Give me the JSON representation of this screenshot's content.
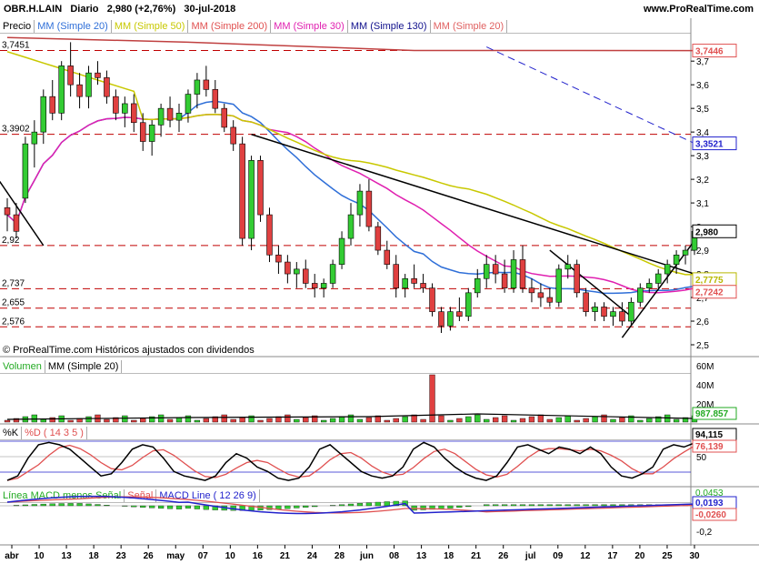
{
  "header": {
    "symbol": "OBR.H.LAIN",
    "period": "Diario",
    "last": "2,980 (+2,76%)",
    "date": "30-jul-2018",
    "site": "www.ProRealTime.com"
  },
  "legends": {
    "price": [
      "Precio",
      "MM (Simple 20)",
      "MM (Simple 50)",
      "MM (Simple 200)",
      "MM (Simple 30)",
      "MM (Simple 130)",
      "MM (Simple 20)"
    ],
    "price_colors": [
      "#000000",
      "#2f6fd8",
      "#c8c800",
      "#e05050",
      "#e020b0",
      "#10108c",
      "#e06060"
    ],
    "volume": [
      "Volumen",
      "MM (Simple 20)"
    ],
    "volume_colors": [
      "#22aa22",
      "#000000"
    ],
    "stoch": [
      "%K",
      "%D ( 14 3 5 )"
    ],
    "stoch_colors": [
      "#000000",
      "#e05050"
    ],
    "macd": [
      "Línea MACD menos Señal",
      "Señal",
      "MACD Line ( 12 26 9)"
    ],
    "macd_colors": [
      "#22aa22",
      "#e05050",
      "#2222cc"
    ]
  },
  "credit": "© ProRealTime.com  Históricos ajustados con dividendos",
  "levels_left": [
    "3,7451",
    "3,3902",
    "2,92",
    "2,737",
    "2,655",
    "2,576"
  ],
  "price_boxes": [
    {
      "text": "3,7446",
      "color": "#e05050"
    },
    {
      "text": "3,3521",
      "color": "#2222cc"
    },
    {
      "text": "2,980",
      "color": "#000000"
    },
    {
      "text": "2,7775",
      "color": "#b8b800"
    },
    {
      "text": "2,7242",
      "color": "#e05050"
    }
  ],
  "volume_axis": [
    "60M",
    "40M",
    "20M"
  ],
  "volume_box": "987.857",
  "stoch_axis": [
    "50"
  ],
  "stoch_boxes": [
    "94,115",
    "76,139"
  ],
  "macd_axis": [
    "0",
    "-0,2"
  ],
  "macd_boxes": [
    "0,0193",
    "-0,0260"
  ],
  "macd_partial": "0,0453",
  "chart_data": {
    "type": "candlestick",
    "y_ticks": [
      "3,7",
      "3,6",
      "3,5",
      "3,4",
      "3,3",
      "3,2",
      "3,1",
      "3",
      "2,9",
      "2,8",
      "2,7",
      "2,6",
      "2,5"
    ],
    "ylim": [
      2.45,
      3.82
    ],
    "x_ticks": [
      "abr",
      "10",
      "13",
      "18",
      "23",
      "26",
      "may",
      "07",
      "10",
      "16",
      "21",
      "24",
      "28",
      "jun",
      "08",
      "13",
      "18",
      "21",
      "26",
      "jul",
      "09",
      "12",
      "17",
      "20",
      "25",
      "30"
    ],
    "candles": [
      [
        3.08,
        3.12,
        2.98,
        3.05
      ],
      [
        3.05,
        3.1,
        2.95,
        2.98
      ],
      [
        3.12,
        3.38,
        3.1,
        3.35
      ],
      [
        3.35,
        3.45,
        3.25,
        3.4
      ],
      [
        3.4,
        3.58,
        3.35,
        3.55
      ],
      [
        3.55,
        3.62,
        3.45,
        3.48
      ],
      [
        3.48,
        3.7,
        3.45,
        3.68
      ],
      [
        3.68,
        3.78,
        3.55,
        3.6
      ],
      [
        3.6,
        3.65,
        3.5,
        3.55
      ],
      [
        3.55,
        3.68,
        3.5,
        3.65
      ],
      [
        3.65,
        3.7,
        3.6,
        3.63
      ],
      [
        3.63,
        3.66,
        3.52,
        3.55
      ],
      [
        3.55,
        3.58,
        3.45,
        3.48
      ],
      [
        3.48,
        3.55,
        3.42,
        3.52
      ],
      [
        3.52,
        3.56,
        3.4,
        3.44
      ],
      [
        3.44,
        3.48,
        3.32,
        3.36
      ],
      [
        3.36,
        3.45,
        3.3,
        3.43
      ],
      [
        3.43,
        3.52,
        3.38,
        3.5
      ],
      [
        3.5,
        3.55,
        3.42,
        3.45
      ],
      [
        3.45,
        3.52,
        3.4,
        3.48
      ],
      [
        3.48,
        3.58,
        3.44,
        3.56
      ],
      [
        3.56,
        3.65,
        3.5,
        3.62
      ],
      [
        3.62,
        3.68,
        3.55,
        3.58
      ],
      [
        3.58,
        3.62,
        3.48,
        3.5
      ],
      [
        3.5,
        3.52,
        3.4,
        3.42
      ],
      [
        3.42,
        3.45,
        3.32,
        3.35
      ],
      [
        3.35,
        3.38,
        2.92,
        2.95
      ],
      [
        2.95,
        3.3,
        2.9,
        3.28
      ],
      [
        3.28,
        3.3,
        3.02,
        3.05
      ],
      [
        3.05,
        3.08,
        2.85,
        2.88
      ],
      [
        2.88,
        2.92,
        2.8,
        2.85
      ],
      [
        2.85,
        2.88,
        2.76,
        2.8
      ],
      [
        2.8,
        2.85,
        2.74,
        2.82
      ],
      [
        2.82,
        2.86,
        2.74,
        2.76
      ],
      [
        2.76,
        2.8,
        2.7,
        2.74
      ],
      [
        2.74,
        2.78,
        2.7,
        2.76
      ],
      [
        2.76,
        2.86,
        2.74,
        2.84
      ],
      [
        2.84,
        2.98,
        2.82,
        2.95
      ],
      [
        2.95,
        3.1,
        2.92,
        3.05
      ],
      [
        3.05,
        3.18,
        3.0,
        3.15
      ],
      [
        3.15,
        3.2,
        2.98,
        3.0
      ],
      [
        3.0,
        3.02,
        2.88,
        2.9
      ],
      [
        2.9,
        2.94,
        2.82,
        2.84
      ],
      [
        2.84,
        2.88,
        2.7,
        2.74
      ],
      [
        2.74,
        2.8,
        2.7,
        2.78
      ],
      [
        2.78,
        2.84,
        2.74,
        2.76
      ],
      [
        2.76,
        2.8,
        2.72,
        2.74
      ],
      [
        2.74,
        2.76,
        2.62,
        2.64
      ],
      [
        2.64,
        2.66,
        2.55,
        2.58
      ],
      [
        2.58,
        2.66,
        2.56,
        2.64
      ],
      [
        2.64,
        2.7,
        2.6,
        2.62
      ],
      [
        2.62,
        2.74,
        2.6,
        2.72
      ],
      [
        2.72,
        2.82,
        2.7,
        2.78
      ],
      [
        2.78,
        2.88,
        2.74,
        2.84
      ],
      [
        2.84,
        2.88,
        2.76,
        2.8
      ],
      [
        2.8,
        2.86,
        2.72,
        2.74
      ],
      [
        2.74,
        2.9,
        2.72,
        2.86
      ],
      [
        2.86,
        2.92,
        2.72,
        2.74
      ],
      [
        2.74,
        2.78,
        2.68,
        2.72
      ],
      [
        2.72,
        2.76,
        2.66,
        2.7
      ],
      [
        2.7,
        2.74,
        2.66,
        2.68
      ],
      [
        2.68,
        2.84,
        2.66,
        2.82
      ],
      [
        2.82,
        2.88,
        2.78,
        2.84
      ],
      [
        2.84,
        2.86,
        2.7,
        2.72
      ],
      [
        2.72,
        2.74,
        2.62,
        2.64
      ],
      [
        2.64,
        2.68,
        2.6,
        2.66
      ],
      [
        2.66,
        2.68,
        2.6,
        2.62
      ],
      [
        2.62,
        2.66,
        2.58,
        2.64
      ],
      [
        2.64,
        2.68,
        2.58,
        2.6
      ],
      [
        2.6,
        2.7,
        2.58,
        2.68
      ],
      [
        2.68,
        2.76,
        2.66,
        2.74
      ],
      [
        2.74,
        2.78,
        2.72,
        2.76
      ],
      [
        2.76,
        2.82,
        2.74,
        2.8
      ],
      [
        2.8,
        2.86,
        2.76,
        2.84
      ],
      [
        2.84,
        2.9,
        2.8,
        2.88
      ],
      [
        2.88,
        2.92,
        2.84,
        2.9
      ],
      [
        2.9,
        3.0,
        2.88,
        2.98
      ]
    ]
  }
}
